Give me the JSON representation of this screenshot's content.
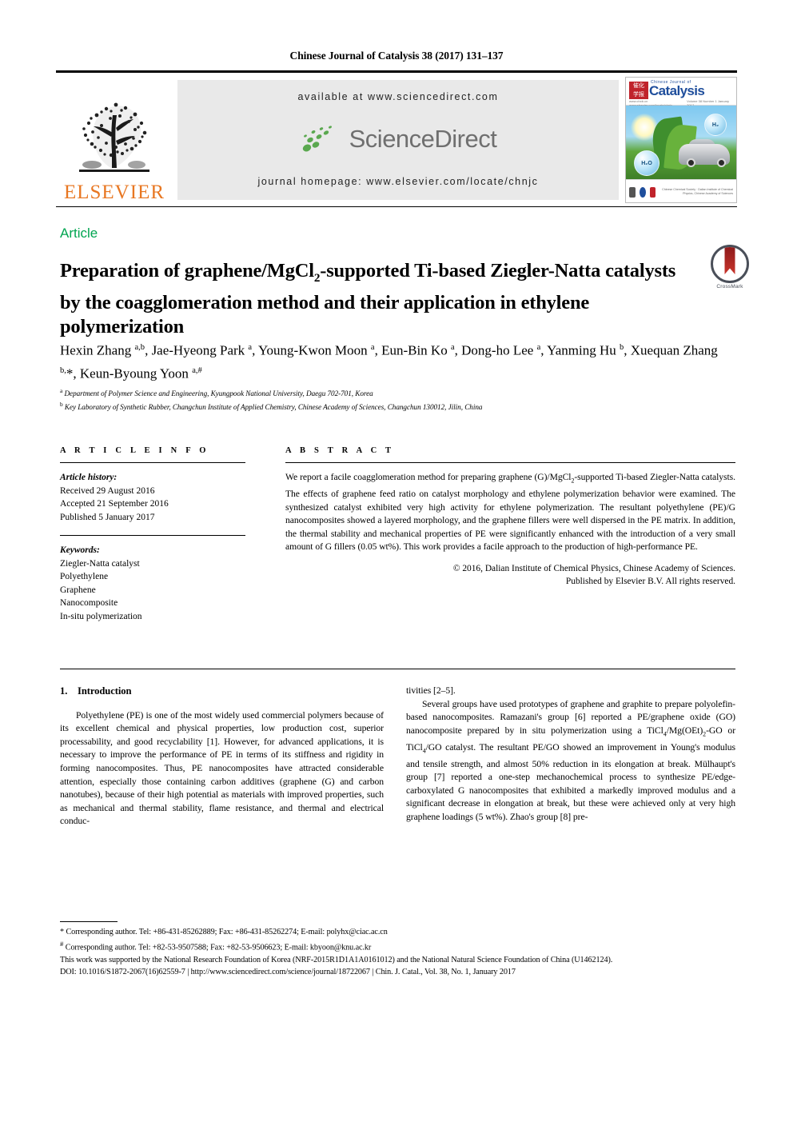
{
  "running_head": "Chinese Journal of Catalysis 38 (2017) 131–137",
  "masthead": {
    "publisher_name": "ELSEVIER",
    "available_at": "available at www.sciencedirect.com",
    "sciencedirect_wordmark": "ScienceDirect",
    "journal_homepage": "journal homepage: www.elsevier.com/locate/chnjc",
    "cover": {
      "chinese_line": "Chinese Journal of",
      "title": "Catalysis",
      "issn_left": "www.chxb.cn  www.elsevier.com/locate/chnjc",
      "issue_right": "Volume 38   Number 1   January 2017",
      "bubble_h2": "H₂",
      "bubble_h2o": "H₂O",
      "footer_text": "Chinese Chemical Society · Dalian Institute of Chemical Physics, Chinese Academy of Sciences"
    }
  },
  "article_type": "Article",
  "title_html": "Preparation of graphene/MgCl<sub>2</sub>-supported Ti-based Ziegler-Natta catalysts by the coagglomeration method and their application in ethylene polymerization",
  "crossmark_label": "CrossMark",
  "authors_html": "Hexin Zhang <sup>a,b</sup>, Jae-Hyeong Park <sup>a</sup>, Young-Kwon Moon <sup>a</sup>, Eun-Bin Ko <sup>a</sup>, Dong-ho Lee <sup>a</sup>, Yanming Hu <sup>b</sup>, Xuequan Zhang <sup>b,</sup>*, Keun-Byoung Yoon <sup>a,#</sup>",
  "affiliations_html": "<sup>a</sup> Department of Polymer Science and Engineering, Kyungpook National University, Daegu 702-701, Korea<br><sup>b</sup> Key Laboratory of Synthetic Rubber, Changchun Institute of Applied Chemistry, Chinese Academy of Sciences, Changchun 130012, Jilin, China",
  "article_info": {
    "heading": "A R T I C L E    I N F O",
    "history_label": "Article history:",
    "history": [
      "Received 29 August 2016",
      "Accepted 21 September 2016",
      "Published 5 January 2017"
    ],
    "keywords_label": "Keywords:",
    "keywords": [
      "Ziegler-Natta catalyst",
      "Polyethylene",
      "Graphene",
      "Nanocomposite",
      "In-situ polymerization"
    ]
  },
  "abstract": {
    "heading": "A B S T R A C T",
    "body_html": "We report a facile coagglomeration method for preparing graphene (G)/MgCl<sub>2</sub>-supported Ti-based Ziegler-Natta catalysts. The effects of graphene feed ratio on catalyst morphology and ethylene polymerization behavior were examined. The synthesized catalyst exhibited very high activity for ethylene polymerization. The resultant polyethylene (PE)/G nanocomposites showed a layered morphology, and the graphene fillers were well dispersed in the PE matrix. In addition, the thermal stability and mechanical properties of PE were significantly enhanced with the introduction of a very small amount of G fillers (0.05 wt%). This work provides a facile approach to the production of high-performance PE.",
    "copyright_line_1": "© 2016, Dalian Institute of Chemical Physics, Chinese Academy of Sciences.",
    "copyright_line_2": "Published by Elsevier B.V. All rights reserved."
  },
  "body": {
    "section_number": "1.",
    "section_title": "Introduction",
    "left_paragraph_1": "Polyethylene (PE) is one of the most widely used commercial polymers because of its excellent chemical and physical properties, low production cost, superior processability, and good recyclability [1]. However, for advanced applications, it is necessary to improve the performance of PE in terms of its stiffness and rigidity in forming nanocomposites. Thus, PE nanocomposites have attracted considerable attention, especially those containing carbon additives (graphene (G) and carbon nanotubes), because of their high potential as materials with improved properties, such as mechanical and thermal stability, flame resistance, and thermal and electrical conduc-",
    "right_continuation": "tivities [2–5].",
    "right_paragraph_html": "Several groups have used prototypes of graphene and graphite to prepare polyolefin-based nanocomposites. Ramazani's group [6] reported a PE/graphene oxide (GO) nanocomposite prepared by in situ polymerization using a TiCl<sub>4</sub>/Mg(OEt)<sub>2</sub>-GO or TiCl<sub>4</sub>/GO catalyst. The resultant PE/GO showed an improvement in Young's modulus and tensile strength, and almost 50% reduction in its elongation at break. Mülhaupt's group [7] reported a one-step mechanochemical process to synthesize PE/edge-carboxylated G nanocomposites that exhibited a markedly improved modulus and a significant decrease in elongation at break, but these were achieved only at very high graphene loadings (5 wt%). Zhao's group [8] pre-"
  },
  "footnotes": {
    "corresponding_1_html": "* Corresponding author. Tel: +86-431-85262889; Fax: +86-431-85262274; E-mail: polyhx@ciac.ac.cn",
    "corresponding_2_html": "<sup>#</sup> Corresponding author. Tel: +82-53-9507588; Fax: +82-53-9506623; E-mail: kbyoon@knu.ac.kr",
    "funding": "This work was supported by the National Research Foundation of Korea (NRF-2015R1D1A1A0161012) and the National Natural Science Foundation of China (U1462124).",
    "doi_line": "DOI: 10.1016/S1872-2067(16)62559-7 | http://www.sciencedirect.com/science/journal/18722067 | Chin. J. Catal., Vol. 38, No. 1, January 2017"
  },
  "colors": {
    "article_type_green": "#00A550",
    "elsevier_orange": "#E87722",
    "sciencedirect_gray": "#6F6F6F",
    "sciencedirect_leaf_green": "#5AA84F",
    "banner_background": "#E9E9E9"
  }
}
